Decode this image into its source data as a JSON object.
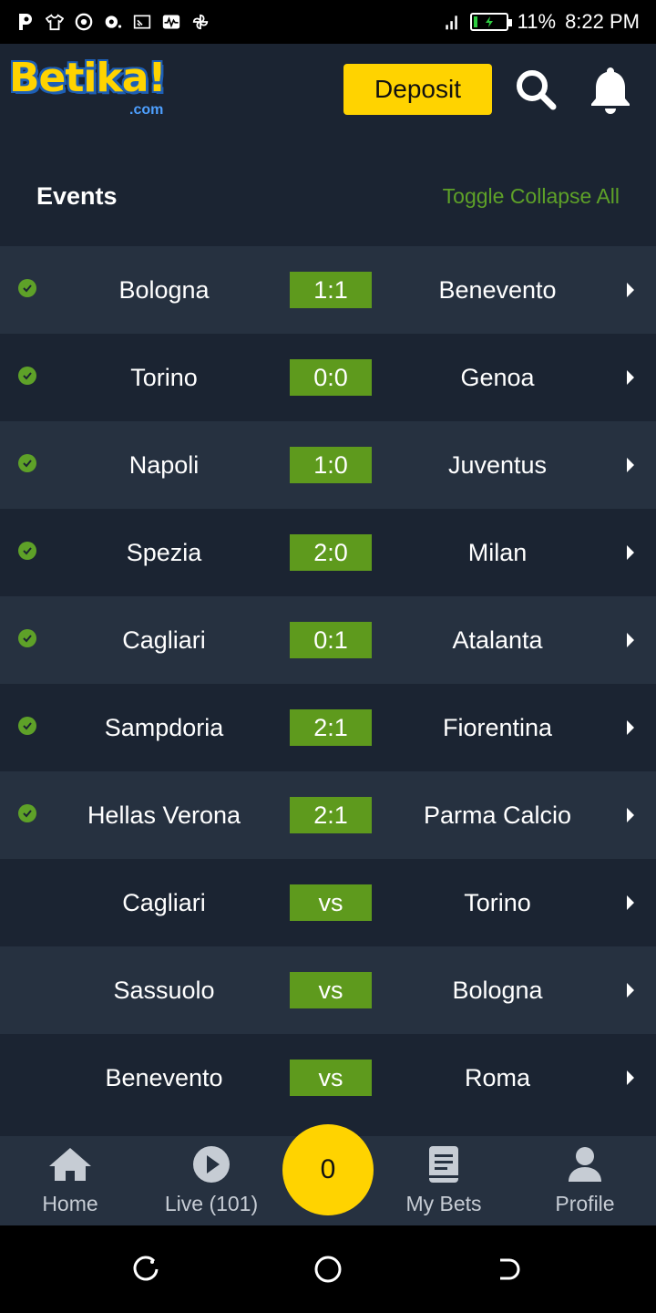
{
  "status_bar": {
    "battery": "11%",
    "time": "8:22 PM"
  },
  "header": {
    "logo_text": "Betika!",
    "logo_sub": ".com",
    "deposit_label": "Deposit"
  },
  "events": {
    "title": "Events",
    "toggle_label": "Toggle Collapse All",
    "rows": [
      {
        "home": "Bologna",
        "score": "1:1",
        "away": "Benevento",
        "finished": true
      },
      {
        "home": "Torino",
        "score": "0:0",
        "away": "Genoa",
        "finished": true
      },
      {
        "home": "Napoli",
        "score": "1:0",
        "away": "Juventus",
        "finished": true
      },
      {
        "home": "Spezia",
        "score": "2:0",
        "away": "Milan",
        "finished": true
      },
      {
        "home": "Cagliari",
        "score": "0:1",
        "away": "Atalanta",
        "finished": true
      },
      {
        "home": "Sampdoria",
        "score": "2:1",
        "away": "Fiorentina",
        "finished": true
      },
      {
        "home": "Hellas Verona",
        "score": "2:1",
        "away": "Parma Calcio",
        "finished": true
      },
      {
        "home": "Cagliari",
        "score": "vs",
        "away": "Torino",
        "finished": false
      },
      {
        "home": "Sassuolo",
        "score": "vs",
        "away": "Bologna",
        "finished": false
      },
      {
        "home": "Benevento",
        "score": "vs",
        "away": "Roma",
        "finished": false
      }
    ]
  },
  "bottom_nav": {
    "home": "Home",
    "live": "Live (101)",
    "betslip_count": "0",
    "my_bets": "My Bets",
    "profile": "Profile"
  },
  "colors": {
    "accent_yellow": "#ffd300",
    "score_green": "#5e9a1d",
    "background": "#1b2432",
    "row_light": "#263140"
  }
}
